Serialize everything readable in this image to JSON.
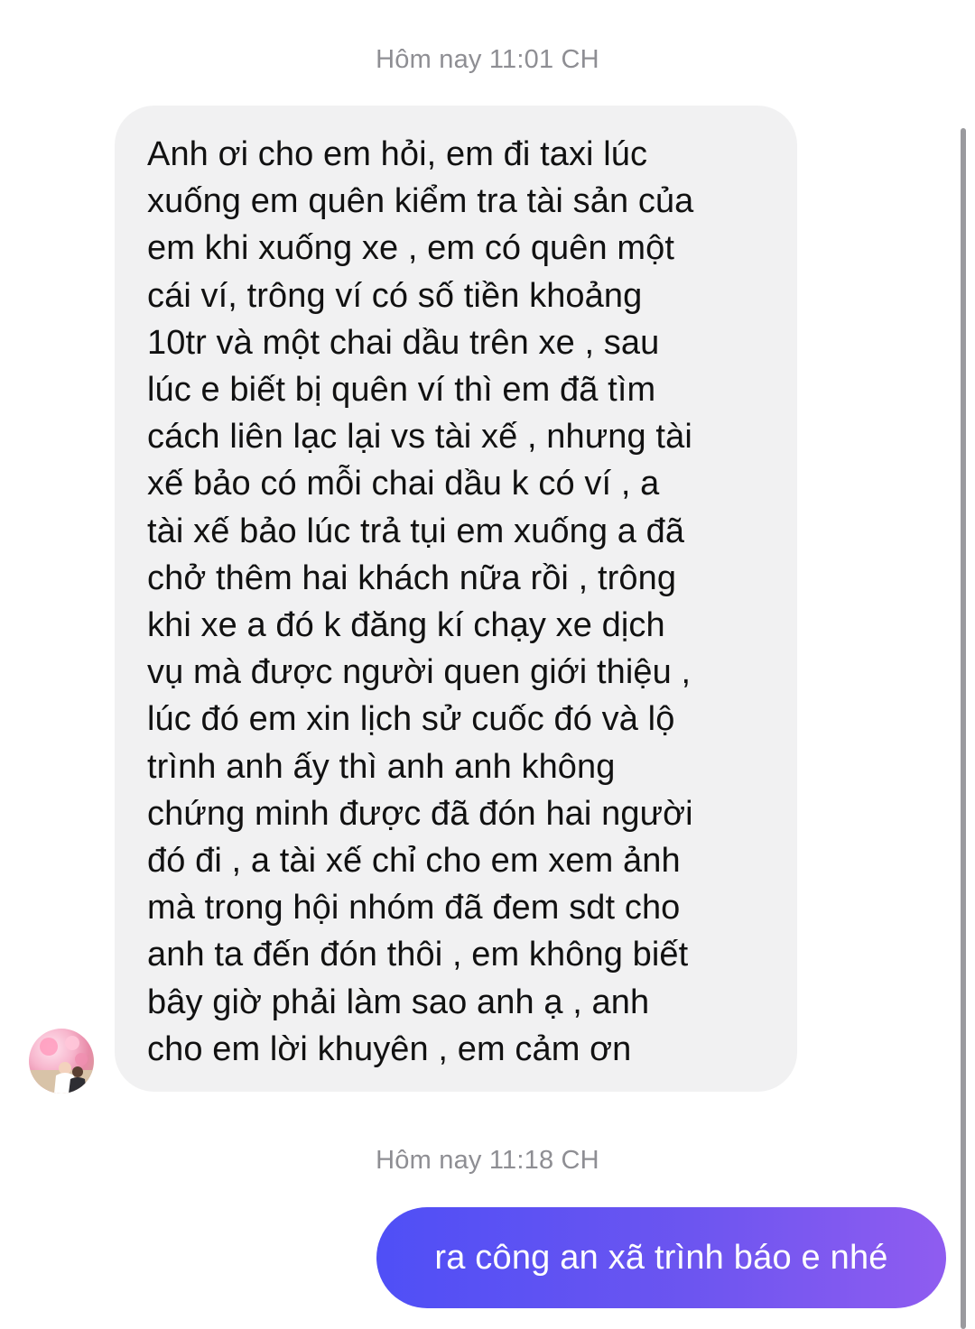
{
  "chat": {
    "timestamp_1": "Hôm nay 11:01 CH",
    "incoming_message": "Anh ơi cho em hỏi, em đi taxi lúc\nxuống em quên kiểm tra tài sản của\nem khi xuống xe , em có quên một\ncái ví, trông ví có số tiền khoảng\n10tr  và một chai  dầu trên xe , sau\nlúc e biết bị quên ví thì em đã tìm\ncách liên lạc lại vs tài xế , nhưng tài\nxế bảo có mỗi chai dầu k có ví , a\ntài xế bảo lúc trả tụi em xuống a đã\nchở thêm hai khách nữa rồi , trông\nkhi xe a đó k đăng kí chạy xe dịch\nvụ mà được người quen giới thiệu ,\nlúc đó em xin lịch sử cuốc đó và lộ\ntrình anh ấy thì anh anh không\nchứng minh được đã đón hai người\nđó đi , a tài xế chỉ cho em xem ảnh\nmà trong hội nhóm đã đem sdt cho\nanh ta đến đón thôi , em không biết\nbây giờ phải làm sao anh ạ , anh\ncho em lời khuyên , em cảm ơn",
    "timestamp_2": "Hôm nay 11:18 CH",
    "outgoing_message": "ra công an xã trình báo e nhé"
  },
  "avatar": {
    "icon": "contact-avatar-photo"
  },
  "colors": {
    "incoming_bubble": "#f1f1f2",
    "outgoing_gradient_start": "#4f4ff6",
    "outgoing_gradient_end": "#8f5cf0",
    "timestamp_text": "#8e8e93"
  }
}
